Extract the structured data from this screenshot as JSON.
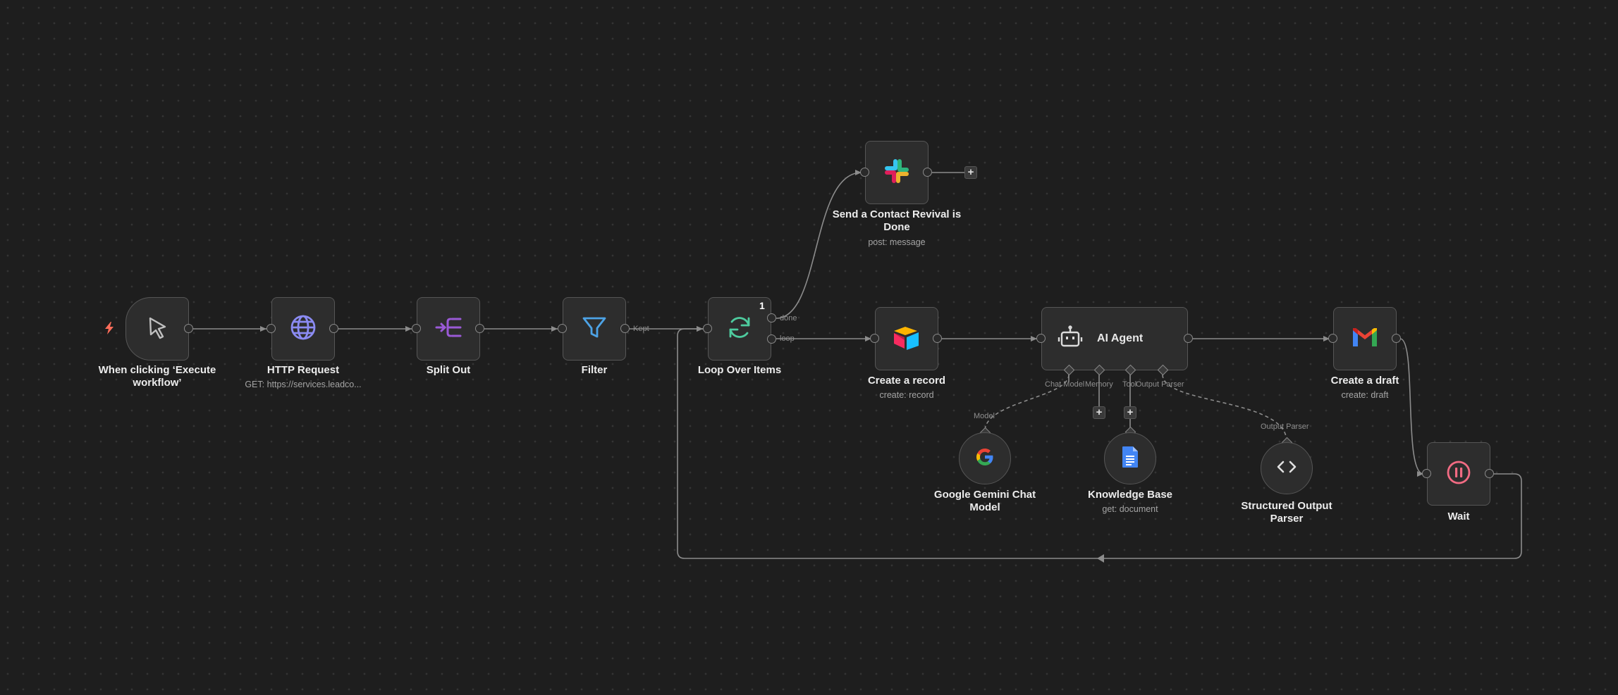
{
  "colors": {
    "canvas": "#1e1e1e",
    "node_bg": "#2d2d2d",
    "node_border": "#565656",
    "wire": "#8c8c8c",
    "trigger_bolt": "#ff6d5a"
  },
  "nodes": {
    "manual_trigger": {
      "label": "When clicking ‘Execute workflow’",
      "icon": "cursor-icon"
    },
    "http_request": {
      "label": "HTTP Request",
      "subtitle": "GET: https://services.leadco...",
      "icon": "globe-icon"
    },
    "split_out": {
      "label": "Split Out",
      "icon": "split-out-icon"
    },
    "filter": {
      "label": "Filter",
      "icon": "funnel-icon"
    },
    "loop_over_items": {
      "label": "Loop Over Items",
      "badge": "1",
      "icon": "refresh-icon"
    },
    "slack": {
      "label": "Send a Contact Revival is Done",
      "subtitle": "post: message",
      "icon": "slack-icon"
    },
    "airtable": {
      "label": "Create a record",
      "subtitle": "create: record",
      "icon": "airtable-icon"
    },
    "ai_agent": {
      "label": "AI Agent",
      "icon": "robot-icon"
    },
    "gmail": {
      "label": "Create a draft",
      "subtitle": "create: draft",
      "icon": "gmail-icon"
    },
    "wait": {
      "label": "Wait",
      "icon": "pause-icon"
    },
    "gemini": {
      "label": "Google Gemini Chat Model",
      "icon": "google-icon"
    },
    "knowledge_base": {
      "label": "Knowledge Base",
      "subtitle": "get: document",
      "icon": "google-docs-icon"
    },
    "output_parser": {
      "label": "Structured Output Parser",
      "icon": "code-brackets-icon"
    }
  },
  "connection_labels": {
    "kept": "Kept",
    "done": "done",
    "loop": "loop",
    "chat_model": "Chat Model",
    "memory": "Memory",
    "tool": "Tool",
    "output_parser": "Output Parser",
    "model": "Model",
    "output_parser_target": "Output Parser"
  },
  "add_button": "+"
}
